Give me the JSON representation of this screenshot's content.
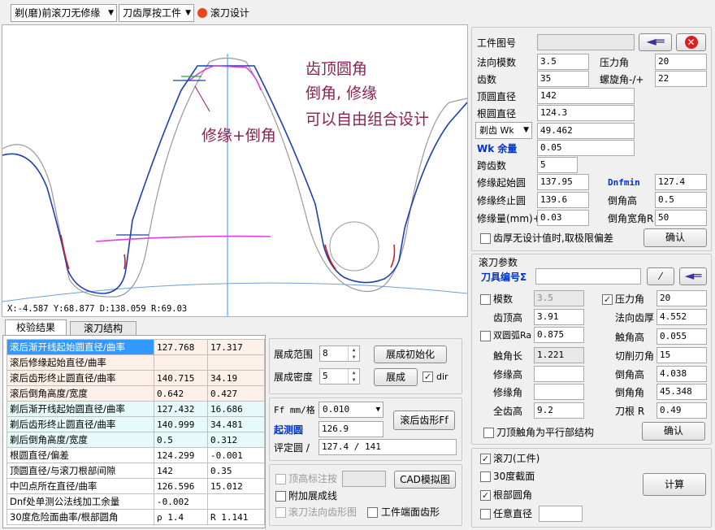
{
  "toolbar": {
    "mode_combo": "剃(磨)前滚刀无修缘",
    "type_combo": "刀齿厚按工件",
    "hob_design": "滚刀设计"
  },
  "drawing": {
    "annotation1": "齿顶圆角",
    "annotation2": "倒角, 修缘",
    "annotation3": "可以自由组合设计",
    "annotation4": "修缘+倒角",
    "coord": "X:-4.587   Y:68.877  D:138.059   R:69.03"
  },
  "tabs": {
    "tab1": "校验结果",
    "tab2": "滚刀结构"
  },
  "results": [
    [
      "滚后渐开线起始圆直径/曲率",
      "127.768",
      "17.317"
    ],
    [
      "滚后修缘起始直径/曲率",
      "",
      ""
    ],
    [
      "滚后齿形终止圆直径/曲率",
      "140.715",
      "34.19"
    ],
    [
      "滚后倒角高度/宽度",
      "0.642",
      "0.427"
    ],
    [
      "剃后渐开线起始圆直径/曲率",
      "127.432",
      "16.686"
    ],
    [
      "剃后齿形终止圆直径/曲率",
      "140.999",
      "34.481"
    ],
    [
      "剃后倒角高度/宽度",
      "0.5",
      "0.312"
    ],
    [
      "根圆直径/偏差",
      "124.299",
      "-0.001"
    ],
    [
      "顶圆直径/与滚刀根部间隙",
      "142",
      "0.35"
    ],
    [
      "中凹点所在直径/曲率",
      "126.596",
      "15.012"
    ],
    [
      "Dnf处单测公法线加工余量",
      "-0.002",
      ""
    ],
    [
      "30度危险面曲率/根部圆角",
      "ρ  1.4",
      "R 1.141"
    ]
  ],
  "expand": {
    "range_label": "展成范围",
    "range_val": "8",
    "density_label": "展成密度",
    "density_val": "5",
    "init_btn": "展成初始化",
    "expand_btn": "展成",
    "dir_label": "dir"
  },
  "ff": {
    "label": "Ff mm/格",
    "value": "0.010",
    "start_label": "起测圆",
    "start_val": "126.9",
    "eval_label": "评定圆 /",
    "eval_val": "127.4 / 141",
    "btn": "滚后齿形Ff"
  },
  "misc": {
    "top_mark": "顶高标注按",
    "cad_btn": "CAD模拟图",
    "extra_line": "附加展成线",
    "hob_normal": "滚刀法向齿形图",
    "end_face": "工件端面齿形"
  },
  "workpiece": {
    "drawing_no_label": "工件图号",
    "drawing_no": "",
    "normal_module_label": "法向模数",
    "normal_module": "3.5",
    "pressure_angle_label": "压力角",
    "pressure_angle": "20",
    "teeth_label": "齿数",
    "teeth": "35",
    "helix_label": "螺旋角-/+",
    "helix": "22",
    "tip_dia_label": "顶圆直径",
    "tip_dia": "142",
    "root_dia_label": "根圆直径",
    "root_dia": "124.3",
    "wk_combo": "剃齿 Wk",
    "wk_val": "49.462",
    "wk_allow_label": "Wk 余量",
    "wk_allow": "0.05",
    "span_label": "跨齿数",
    "span": "5",
    "mod_start_label": "修缘起始圆",
    "mod_start": "137.95",
    "dnfmin_label": "Dnfmin",
    "dnfmin": "127.4",
    "mod_end_label": "修缘终止圆",
    "mod_end": "139.6",
    "chamfer_h_label": "倒角高",
    "chamfer_h": "0.5",
    "mod_amt_label": "修缘量(mm)+",
    "mod_amt": "0.03",
    "chamfer_r_label": "倒角宽角R",
    "chamfer_r": "50",
    "no_design_label": "齿厚无设计值时,取极限偏差",
    "confirm": "确认"
  },
  "hob": {
    "title": "滚刀参数",
    "tool_no_label": "刀具编号Σ",
    "tool_no": "",
    "module_label": "模数",
    "module": "3.5",
    "pa_label": "压力角",
    "pa": "20",
    "addendum_label": "齿顶高",
    "addendum": "3.91",
    "normal_thk_label": "法向齿厚",
    "normal_thk": "4.552",
    "double_arc_label": "双圆弧Ra",
    "double_arc": "0.875",
    "prot_h_label": "触角高",
    "prot_h": "0.055",
    "prot_len_label": "触角长",
    "prot_len": "1.221",
    "cut_angle_label": "切削刃角",
    "cut_angle": "15",
    "mod_h_label": "修缘高",
    "mod_h": "",
    "chamfer_h_label": "倒角高",
    "chamfer_h": "4.038",
    "mod_angle_label": "修缘角",
    "mod_angle": "",
    "chamfer_angle_label": "倒角角",
    "chamfer_angle": "45.348",
    "full_h_label": "全齿高",
    "full_h": "9.2",
    "root_r_label": "刀根 R",
    "root_r": "0.49",
    "parallel_label": "刀顶触角为平行部结构",
    "confirm": "确认"
  },
  "bottom": {
    "hob_wp": "滚刀(工件)",
    "deg30": "30度截面",
    "root_fillet": "根部圆角",
    "any_dia": "任意直径",
    "any_dia_val": "",
    "calc": "计算"
  }
}
